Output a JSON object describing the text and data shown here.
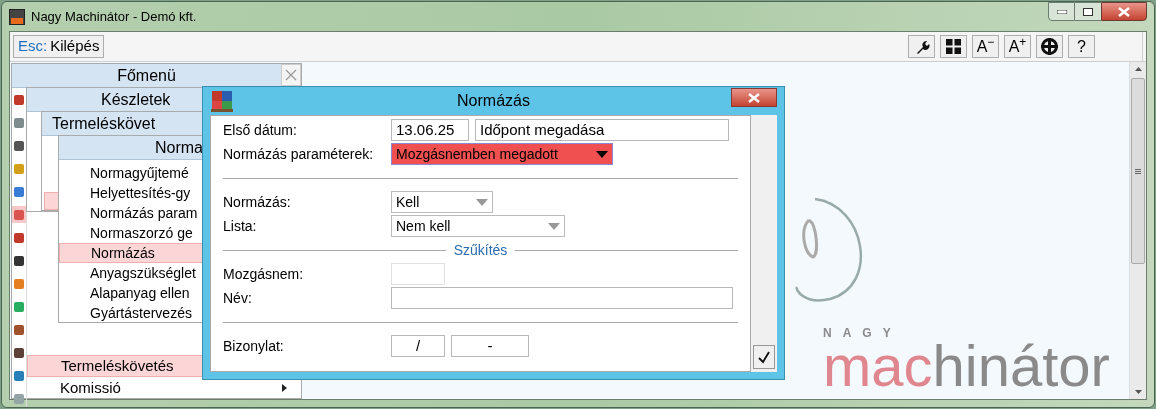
{
  "window": {
    "title": "Nagy Machinátor - Demó kft."
  },
  "toolbar": {
    "exit_button": {
      "key": "Esc:",
      "label": "Kilépés"
    },
    "tools": [
      {
        "kind": "wrench"
      },
      {
        "kind": "grid"
      },
      {
        "kind": "text",
        "label": "A$^{−}$"
      },
      {
        "kind": "text",
        "label": "A$^{+}$"
      },
      {
        "kind": "lifebuoy"
      },
      {
        "kind": "text",
        "label": "?"
      }
    ]
  },
  "menus": [
    {
      "title": "Főmenü",
      "closable": true,
      "left_icons": [
        {
          "selected": false
        },
        {
          "selected": false
        },
        {
          "selected": false
        },
        {
          "selected": false
        },
        {
          "selected": false
        },
        {
          "selected": true
        },
        {
          "selected": false
        },
        {
          "selected": false
        },
        {
          "selected": false
        },
        {
          "selected": false
        },
        {
          "selected": false
        },
        {
          "selected": false
        },
        {
          "selected": false
        },
        {
          "selected": false
        }
      ],
      "items": [
        {
          "label": "Termeléskövetés",
          "selected": true,
          "submenu": false
        },
        {
          "label": "Komissió",
          "selected": false,
          "submenu": true
        }
      ]
    },
    {
      "title": "Készletek"
    },
    {
      "title": "Termeléskövet",
      "selected_row_visible": true
    },
    {
      "title": "Norma",
      "items": [
        {
          "label": "Normagyűjtemé",
          "selected": false
        },
        {
          "label": "Helyettesítés-gy",
          "selected": false
        },
        {
          "label": "Normázás param",
          "selected": false
        },
        {
          "label": "Normaszorzó ge",
          "selected": false
        },
        {
          "label": "Normázás",
          "selected": true
        },
        {
          "label": "Anyagszükséglet",
          "selected": false
        },
        {
          "label": "Alapanyag ellen",
          "selected": false
        },
        {
          "label": "Gyártástervezés",
          "selected": false
        }
      ]
    }
  ],
  "dialog": {
    "title": "Normázás",
    "rows": [
      {
        "kind": "fields",
        "label": "Első dátum:",
        "fields": [
          {
            "value": "13.06.25"
          },
          {
            "value": "Időpont megadása"
          }
        ]
      },
      {
        "kind": "dropdown",
        "label": "Normázás paraméterek:",
        "value": "Mozgásnemben megadott",
        "highlighted": true
      },
      {
        "kind": "divider"
      },
      {
        "kind": "dropdown",
        "label": "Normázás:",
        "value": "Kell",
        "highlighted": false
      },
      {
        "kind": "dropdown",
        "label": "Lista:",
        "value": "Nem kell",
        "highlighted": false
      },
      {
        "kind": "section",
        "label": "Szűkítés"
      },
      {
        "kind": "fields",
        "label": "Mozgásnem:",
        "fields": [
          {
            "disabled": true
          }
        ]
      },
      {
        "kind": "fields",
        "label": "Név:",
        "fields": [
          {
            "disabled": false
          }
        ]
      },
      {
        "kind": "divider"
      },
      {
        "kind": "fields",
        "label": "Bizonylat:",
        "fields": [
          {
            "value": "/"
          },
          {
            "value": "-"
          }
        ]
      }
    ]
  },
  "logo": {
    "top": "NAGY",
    "left": "mac",
    "right": "hinátor"
  }
}
